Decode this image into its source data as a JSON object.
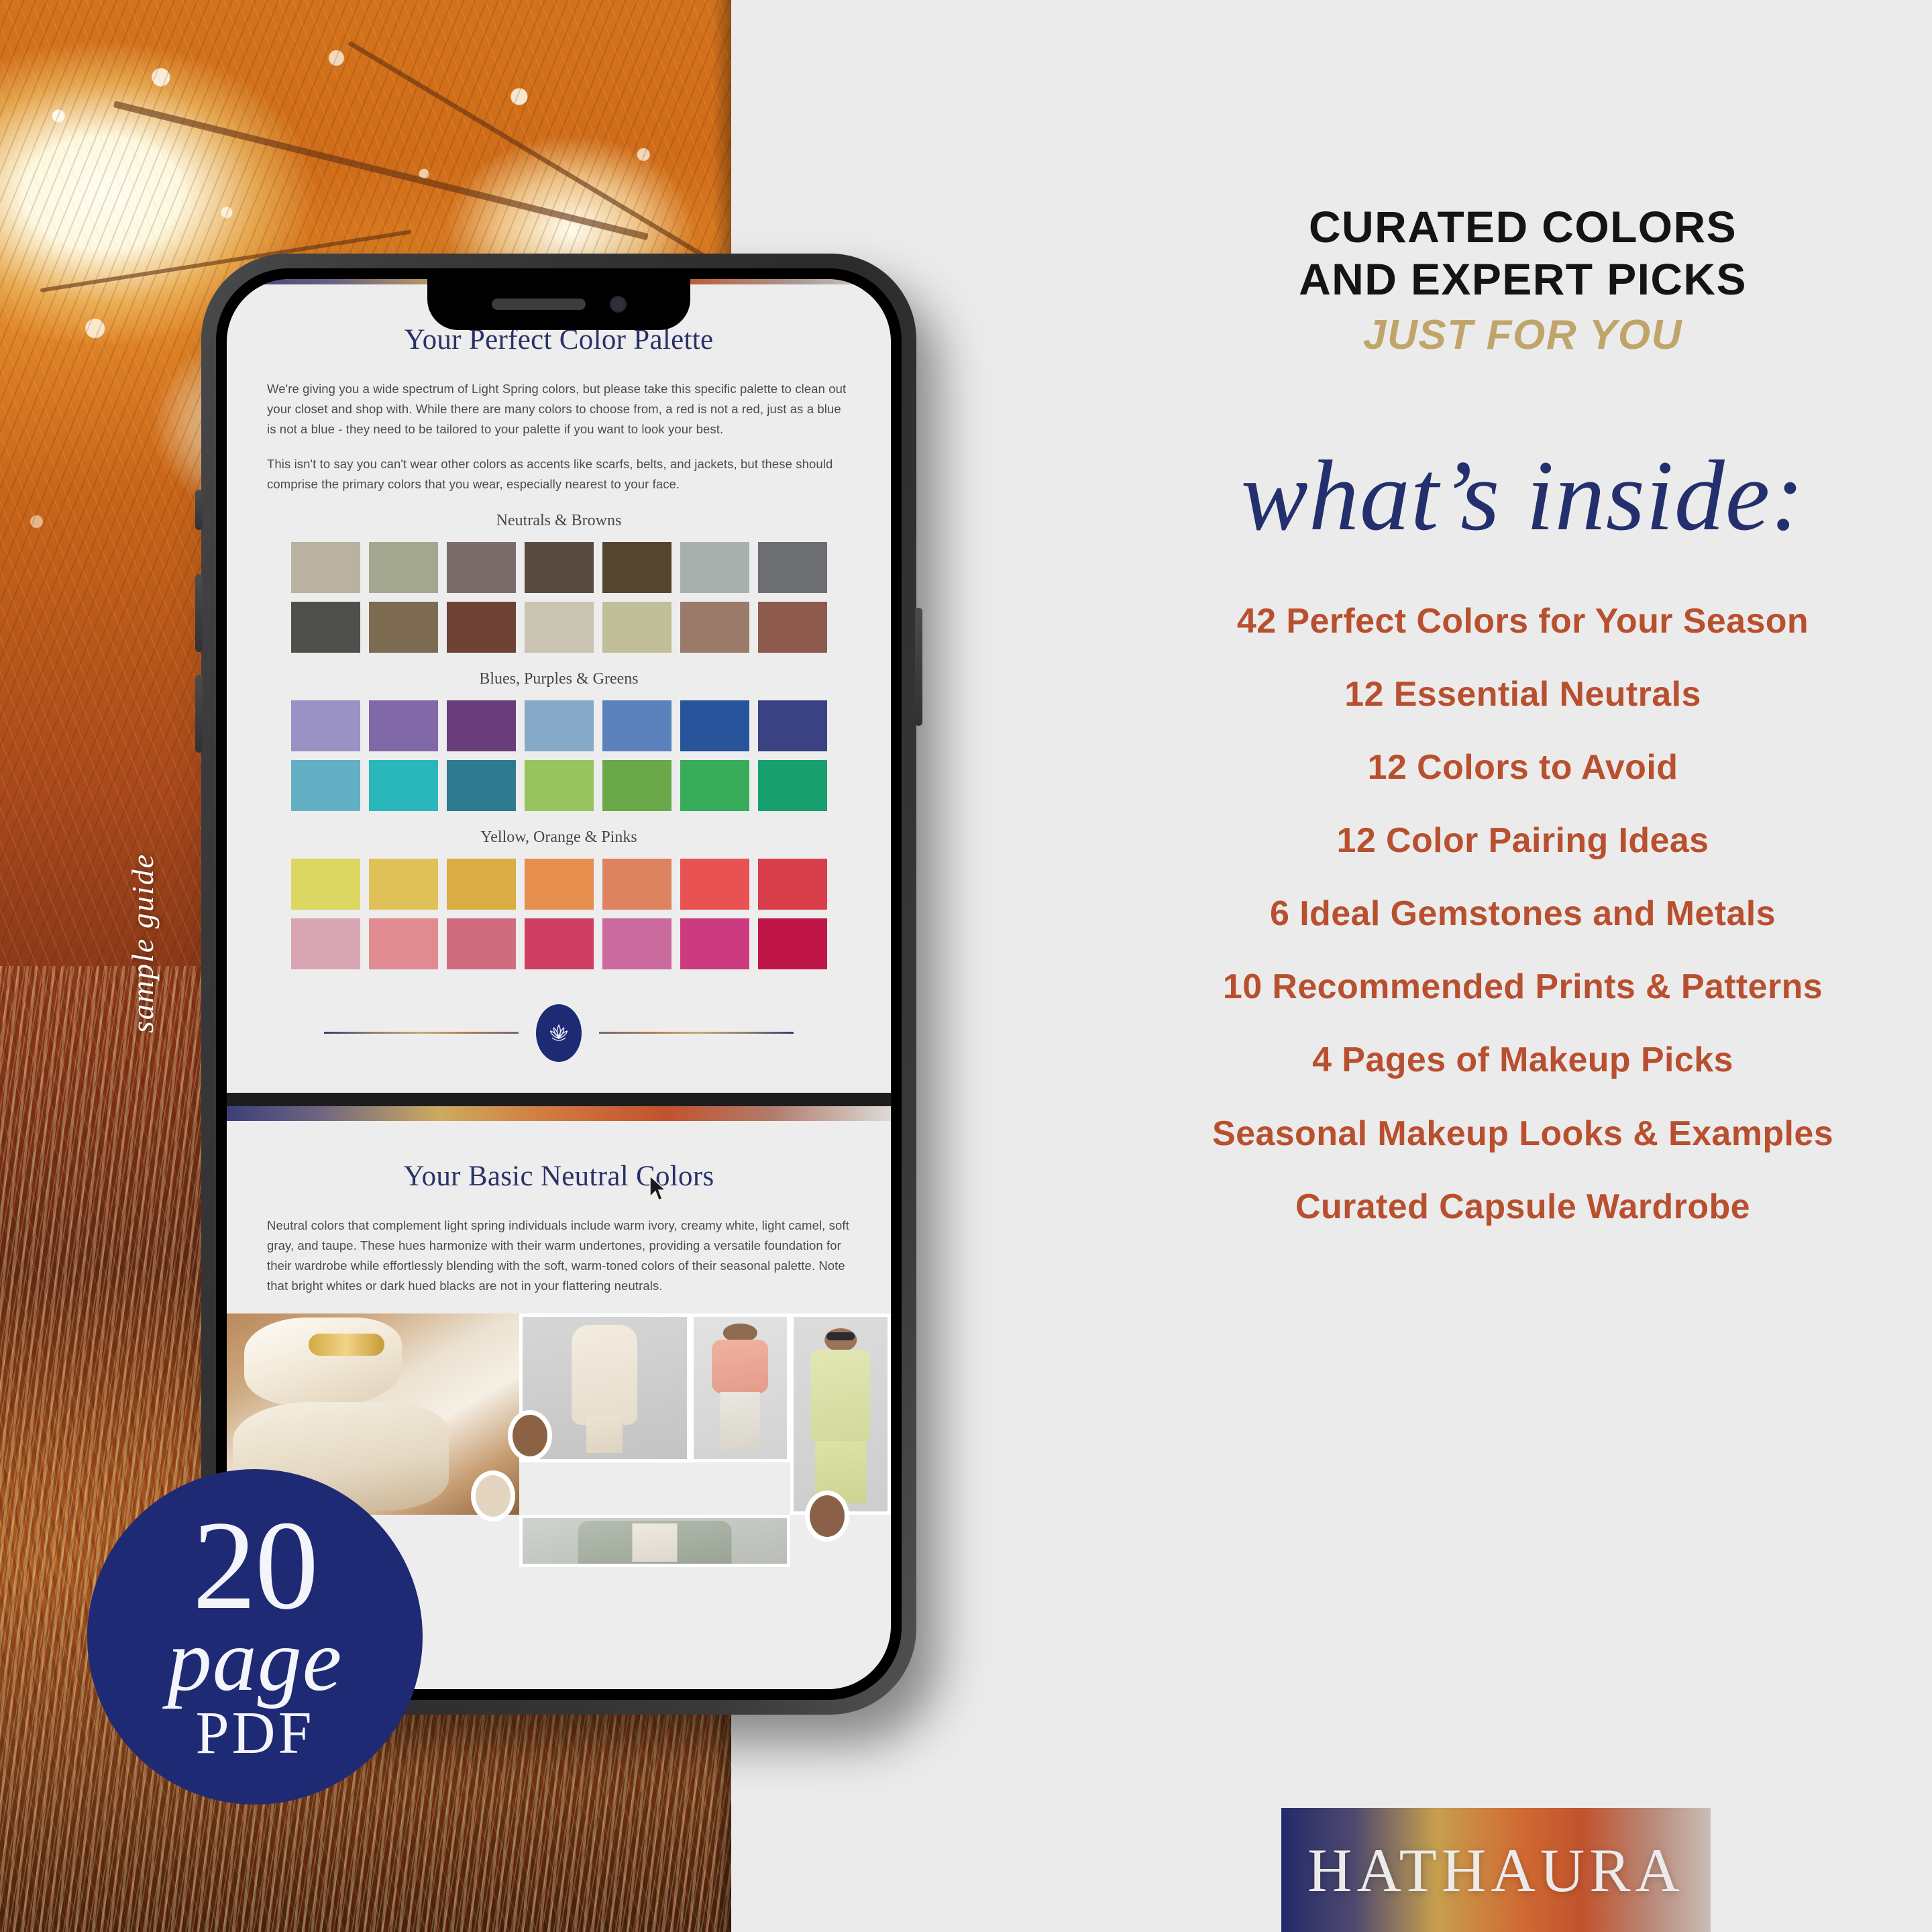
{
  "colors": {
    "navy": "#1f2a75",
    "rust": "#b8502f",
    "gold": "#c0a56b",
    "background": "#ecebeb",
    "doc_title": "#2b3268"
  },
  "left_panel": {
    "sample_guide_label": "sample guide",
    "badge": {
      "number": "20",
      "unit": "page",
      "format": "PDF"
    }
  },
  "phone": {
    "page1": {
      "title": "Your Perfect Color Palette",
      "paragraph1": "We're giving you a wide spectrum of Light Spring colors, but please take this specific palette to clean out your closet and shop with. While there are many colors to choose from, a red is not a red, just as a blue is not a blue - they need to be tailored to your palette if you want to look your best.",
      "paragraph2": "This isn't to say you can't wear other colors as accents like scarfs, belts, and jackets, but these should comprise the primary colors that you wear, especially nearest to your face.",
      "sections": [
        {
          "label": "Neutrals & Browns",
          "row1": [
            "#b9b2a1",
            "#a4a790",
            "#7a6c6b",
            "#584c41",
            "#55452f",
            "#a8b0ad",
            "#6e6f72"
          ],
          "row2": [
            "#4f4f4c",
            "#7d6b52",
            "#6f4236",
            "#c9c3b2",
            "#c0bf98",
            "#9a7a69",
            "#8e5a4d"
          ]
        },
        {
          "label": "Blues, Purples & Greens",
          "row1": [
            "#9a91c4",
            "#8169a8",
            "#6a3d7c",
            "#85a9c6",
            "#5c82bd",
            "#27549a",
            "#3a4283"
          ],
          "row2": [
            "#63b0c4",
            "#29b7bb",
            "#2e7b91",
            "#97c45f",
            "#6aa84a",
            "#38ac5a",
            "#17a06e"
          ]
        },
        {
          "label": "Yellow, Orange & Pinks",
          "row1": [
            "#dcd763",
            "#e0c158",
            "#d9ad44",
            "#e68e4e",
            "#de8360",
            "#e85252",
            "#d83f4b"
          ],
          "row2": [
            "#d7a6b2",
            "#e08b90",
            "#cf6d7e",
            "#cf3f63",
            "#cb6a9c",
            "#cc3b7f",
            "#bf1548"
          ]
        }
      ],
      "divider_icon": "lotus-icon"
    },
    "page2": {
      "title": "Your Basic Neutral Colors",
      "paragraph1": "Neutral colors that complement light spring individuals include warm ivory, creamy white, light camel, soft gray, and taupe. These hues harmonize with their warm undertones, providing a versatile foundation for their wardrobe while effortlessly blending with the soft, warm-toned colors of their seasonal palette. Note that bright whites or dark hued blacks are not in your flattering neutrals.",
      "photo_dots": [
        "#8b6344",
        "#e3d5c0",
        "#8a6148"
      ]
    }
  },
  "right_panel": {
    "kicker_line1": "CURATED COLORS",
    "kicker_line2": "AND EXPERT PICKS",
    "kicker_line3": "JUST FOR YOU",
    "heading": "what’s inside:",
    "features": [
      "42 Perfect Colors for Your Season",
      "12 Essential Neutrals",
      "12 Colors to Avoid",
      "12 Color Pairing Ideas",
      "6 Ideal Gemstones and Metals",
      "10 Recommended Prints & Patterns",
      "4 Pages of Makeup Picks",
      "Seasonal Makeup Looks & Examples",
      "Curated Capsule Wardrobe"
    ],
    "logo": "HATHAURA"
  }
}
